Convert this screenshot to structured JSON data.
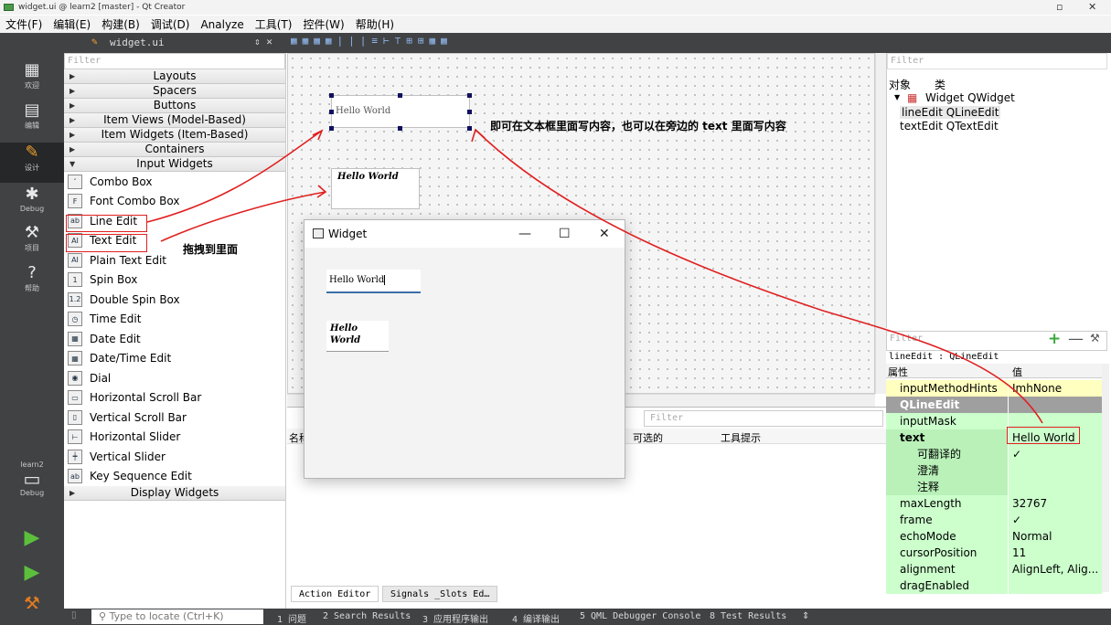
{
  "window": {
    "title": "widget.ui @ learn2 [master] - Qt Creator",
    "minimize": "▫",
    "close": "✕"
  },
  "menu": [
    "文件(F)",
    "编辑(E)",
    "构建(B)",
    "调试(D)",
    "Analyze",
    "工具(T)",
    "控件(W)",
    "帮助(H)"
  ],
  "modes": [
    {
      "label": "欢迎",
      "icon": "grid-icon",
      "glyph": "▦"
    },
    {
      "label": "编辑",
      "icon": "edit-icon",
      "glyph": "▤"
    },
    {
      "label": "设计",
      "icon": "pencil-icon",
      "glyph": "✎"
    },
    {
      "label": "Debug",
      "icon": "bug-icon",
      "glyph": "✱"
    },
    {
      "label": "项目",
      "icon": "wrench-icon",
      "glyph": "⚒"
    },
    {
      "label": "帮助",
      "icon": "help-icon",
      "glyph": "?"
    }
  ],
  "kit": {
    "project": "learn2",
    "config": "Debug"
  },
  "toolbar": {
    "file": "widget.ui"
  },
  "widgetbox": {
    "filter_placeholder": "Filter",
    "categories": [
      "Layouts",
      "Spacers",
      "Buttons",
      "Item Views (Model-Based)",
      "Item Widgets (Item-Based)",
      "Containers",
      "Input Widgets"
    ],
    "items": [
      "Combo Box",
      "Font Combo Box",
      "Line Edit",
      "Text Edit",
      "Plain Text Edit",
      "Spin Box",
      "Double Spin Box",
      "Time Edit",
      "Date Edit",
      "Date/Time Edit",
      "Dial",
      "Horizontal Scroll Bar",
      "Vertical Scroll Bar",
      "Horizontal Slider",
      "Vertical Slider",
      "Key Sequence Edit"
    ],
    "item_icons": [
      "ʻ",
      "F",
      "ab",
      "AI",
      "AI",
      "1",
      "1.2",
      "◷",
      "▦",
      "▦",
      "◉",
      "▭",
      "▯",
      "⊢",
      "┿",
      "ab"
    ],
    "last_category": "Display Widgets"
  },
  "design": {
    "lineedit_text": "Hello World",
    "textedit_text": "Hello World"
  },
  "annotations": {
    "tip": "即可在文本框里面写内容，也可以在旁边的 text 里面写内容",
    "drag": "拖拽到里面"
  },
  "preview": {
    "title": "Widget",
    "lineedit_text": "Hello World",
    "textedit_line1": "Hello",
    "textedit_line2": "World",
    "btn_min": "—",
    "btn_max": "☐",
    "btn_close": "✕"
  },
  "bottom": {
    "filter": "Filter",
    "col_name": "名称",
    "col_checkable": "可选的",
    "col_tooltip": "工具提示",
    "tab1": "Action Editor",
    "tab2": "Signals _Slots Ed…"
  },
  "objects": {
    "filter": "Filter",
    "col_obj": "对象",
    "col_class": "类",
    "rows": [
      {
        "name": "Widget",
        "cls": "QWidget"
      },
      {
        "name": "lineEdit",
        "cls": "QLineEdit"
      },
      {
        "name": "textEdit",
        "cls": "QTextEdit"
      }
    ]
  },
  "props": {
    "filter": "Filter",
    "object": "lineEdit : QLineEdit",
    "col_prop": "属性",
    "col_value": "值",
    "rows": [
      {
        "k": "inputMethodHints",
        "v": "ImhNone",
        "cls": "g1"
      },
      {
        "k": "QLineEdit",
        "v": "",
        "cls": "sec"
      },
      {
        "k": "inputMask",
        "v": "",
        "cls": "g2"
      },
      {
        "k": "text",
        "v": "Hello World",
        "cls": "g3"
      },
      {
        "k": "可翻译的",
        "v": "✓",
        "cls": "g3"
      },
      {
        "k": "澄清",
        "v": "",
        "cls": "g3"
      },
      {
        "k": "注释",
        "v": "",
        "cls": "g3"
      },
      {
        "k": "maxLength",
        "v": "32767",
        "cls": "g2"
      },
      {
        "k": "frame",
        "v": "✓",
        "cls": "g2"
      },
      {
        "k": "echoMode",
        "v": "Normal",
        "cls": "g2"
      },
      {
        "k": "cursorPosition",
        "v": "11",
        "cls": "g2"
      },
      {
        "k": "alignment",
        "v": "AlignLeft, Alig...",
        "cls": "g2"
      },
      {
        "k": "dragEnabled",
        "v": "",
        "cls": "g2"
      }
    ]
  },
  "status": {
    "locate": "Type to locate (Ctrl+K)",
    "panes": [
      "1 问题",
      "2 Search Results",
      "3 应用程序输出",
      "4 编译输出",
      "5 QML Debugger Console",
      "8 Test Results"
    ],
    "more": "⇕"
  }
}
